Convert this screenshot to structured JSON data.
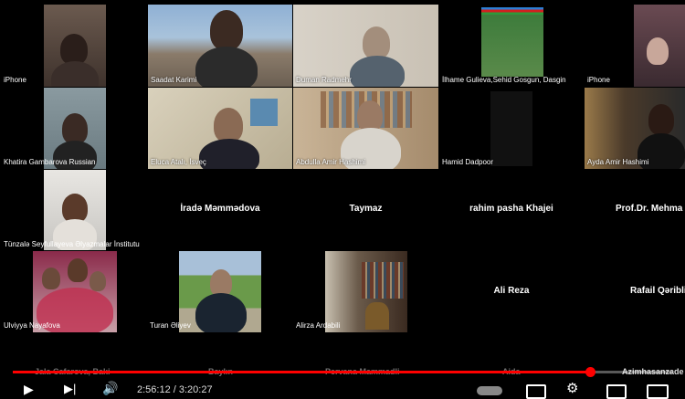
{
  "participants": [
    {
      "name": "iPhone"
    },
    {
      "name": "Saadat Karimi"
    },
    {
      "name": "Duman Radmehr"
    },
    {
      "name": "İlhame Gulieva,Sehid Gosgun, Dasgin"
    },
    {
      "name": "iPhone"
    },
    {
      "name": "Khatira Gambarova Russian"
    },
    {
      "name": "Eluca Atalı, İsveç"
    },
    {
      "name": "Abdulla Amir Hashimi"
    },
    {
      "name": "Hamid Dadpoor"
    },
    {
      "name": "Ayda Amir Hashimi"
    },
    {
      "name": "Tünzalə Seyfullayeva Əlyazmalar İnstitutu"
    },
    {
      "name": "İradə Məmmədova"
    },
    {
      "name": "Taymaz"
    },
    {
      "name": "rahim pasha Khajei"
    },
    {
      "name": "Prof.Dr. Mehma"
    },
    {
      "name": "Ulviyya Nayafova"
    },
    {
      "name": "Turan Əliyev"
    },
    {
      "name": "Alirza Ardabili"
    },
    {
      "name": "Ali Reza"
    },
    {
      "name": "Rafail Qəribli"
    }
  ],
  "overlay_names": [
    "Jala Cafarova, Baki",
    "Baylın",
    "Pervana Mammadli",
    "Aida",
    "Azimhasanzade"
  ],
  "player": {
    "time": "2:56:12 / 3:20:27",
    "progress_percent": 87.5,
    "accent": "#ff0000"
  }
}
